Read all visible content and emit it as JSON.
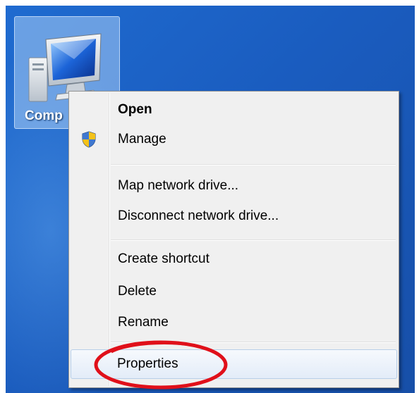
{
  "desktop": {
    "icon": {
      "name": "computer-icon",
      "label": "Comp"
    }
  },
  "context_menu": {
    "items": [
      {
        "label": "Open",
        "bold": true
      },
      {
        "label": "Manage",
        "icon": "uac-shield-icon"
      },
      {
        "label": "Map network drive..."
      },
      {
        "label": "Disconnect network drive..."
      },
      {
        "label": "Create shortcut"
      },
      {
        "label": "Delete"
      },
      {
        "label": "Rename"
      },
      {
        "label": "Properties",
        "highlighted": true
      }
    ]
  },
  "annotation": {
    "shape": "red-ellipse",
    "color": "#e0101a"
  },
  "colors": {
    "desktop_blue": "#1a5cbf",
    "menu_bg": "#f0f0f0",
    "highlight": "#e3ecf8"
  }
}
